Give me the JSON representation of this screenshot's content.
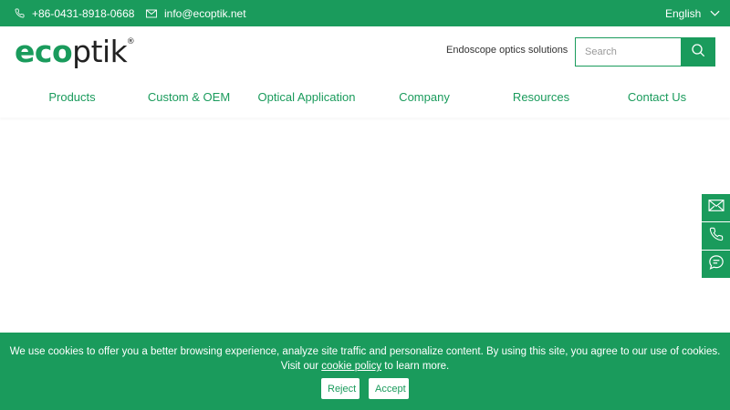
{
  "topbar": {
    "phone": "+86-0431-8918-0668",
    "email": "info@ecoptik.net",
    "language": "English"
  },
  "header": {
    "logo_part1": "eco",
    "logo_part2": "ptik",
    "logo_reg": "®",
    "tagline": "Endoscope optics solutions",
    "search_placeholder": "Search"
  },
  "nav": {
    "items": [
      {
        "label": "Products"
      },
      {
        "label": "Custom & OEM"
      },
      {
        "label": "Optical Application"
      },
      {
        "label": "Company"
      },
      {
        "label": "Resources"
      },
      {
        "label": "Contact Us"
      }
    ]
  },
  "side_buttons": {
    "icons": [
      "mail-icon",
      "phone-icon",
      "chat-icon"
    ]
  },
  "cookie": {
    "text_before": "We use cookies to offer you a better browsing experience, analyze site traffic and personalize content. By using this site, you agree to our use of cookies. Visit our ",
    "link_text": "cookie policy",
    "text_after": " to learn more.",
    "reject_label": "Reject",
    "accept_label": "Accept"
  },
  "colors": {
    "brand_green": "#1a9b5c",
    "text_dark": "#222222",
    "white": "#ffffff"
  }
}
